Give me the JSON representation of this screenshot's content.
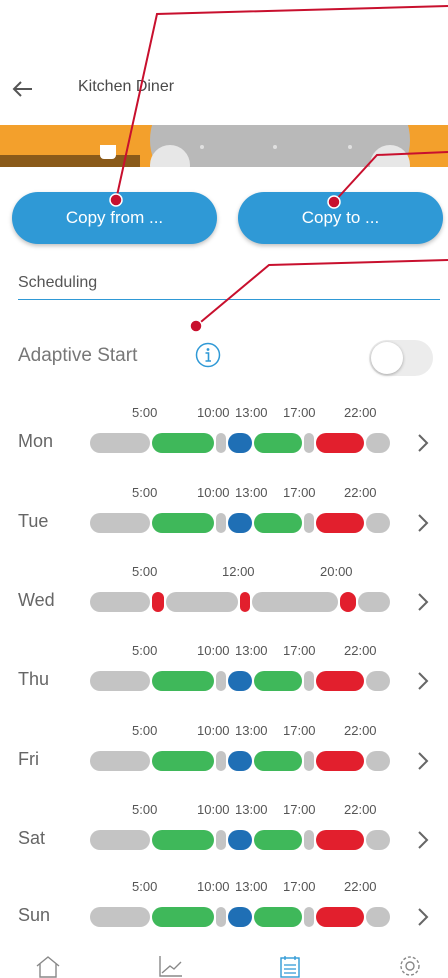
{
  "header": {
    "title": "Kitchen Diner"
  },
  "buttons": {
    "copy_from": "Copy from ...",
    "copy_to": "Copy to ..."
  },
  "tabs": {
    "scheduling": "Scheduling"
  },
  "adaptive_start": {
    "label": "Adaptive Start",
    "enabled": false
  },
  "colors": {
    "accent": "#2f99d6",
    "gray": "#c4c4c4",
    "green": "#3fb85a",
    "blue": "#1f6fb5",
    "red": "#e21f2d",
    "banner": "#f3a02c",
    "annotation": "#c8102e"
  },
  "days": [
    {
      "label": "Mon",
      "times": [
        "5:00",
        "10:00",
        "13:00",
        "17:00",
        "22:00"
      ]
    },
    {
      "label": "Tue",
      "times": [
        "5:00",
        "10:00",
        "13:00",
        "17:00",
        "22:00"
      ]
    },
    {
      "label": "Wed",
      "times": [
        "5:00",
        "12:00",
        "20:00"
      ]
    },
    {
      "label": "Thu",
      "times": [
        "5:00",
        "10:00",
        "13:00",
        "17:00",
        "22:00"
      ]
    },
    {
      "label": "Fri",
      "times": [
        "5:00",
        "10:00",
        "13:00",
        "17:00",
        "22:00"
      ]
    },
    {
      "label": "Sat",
      "times": [
        "5:00",
        "10:00",
        "13:00",
        "17:00",
        "22:00"
      ]
    },
    {
      "label": "Sun",
      "times": [
        "5:00",
        "10:00",
        "13:00",
        "17:00",
        "22:00"
      ]
    }
  ],
  "bottom_nav": [
    "home-icon",
    "chart-icon",
    "schedule-icon",
    "settings-icon"
  ]
}
